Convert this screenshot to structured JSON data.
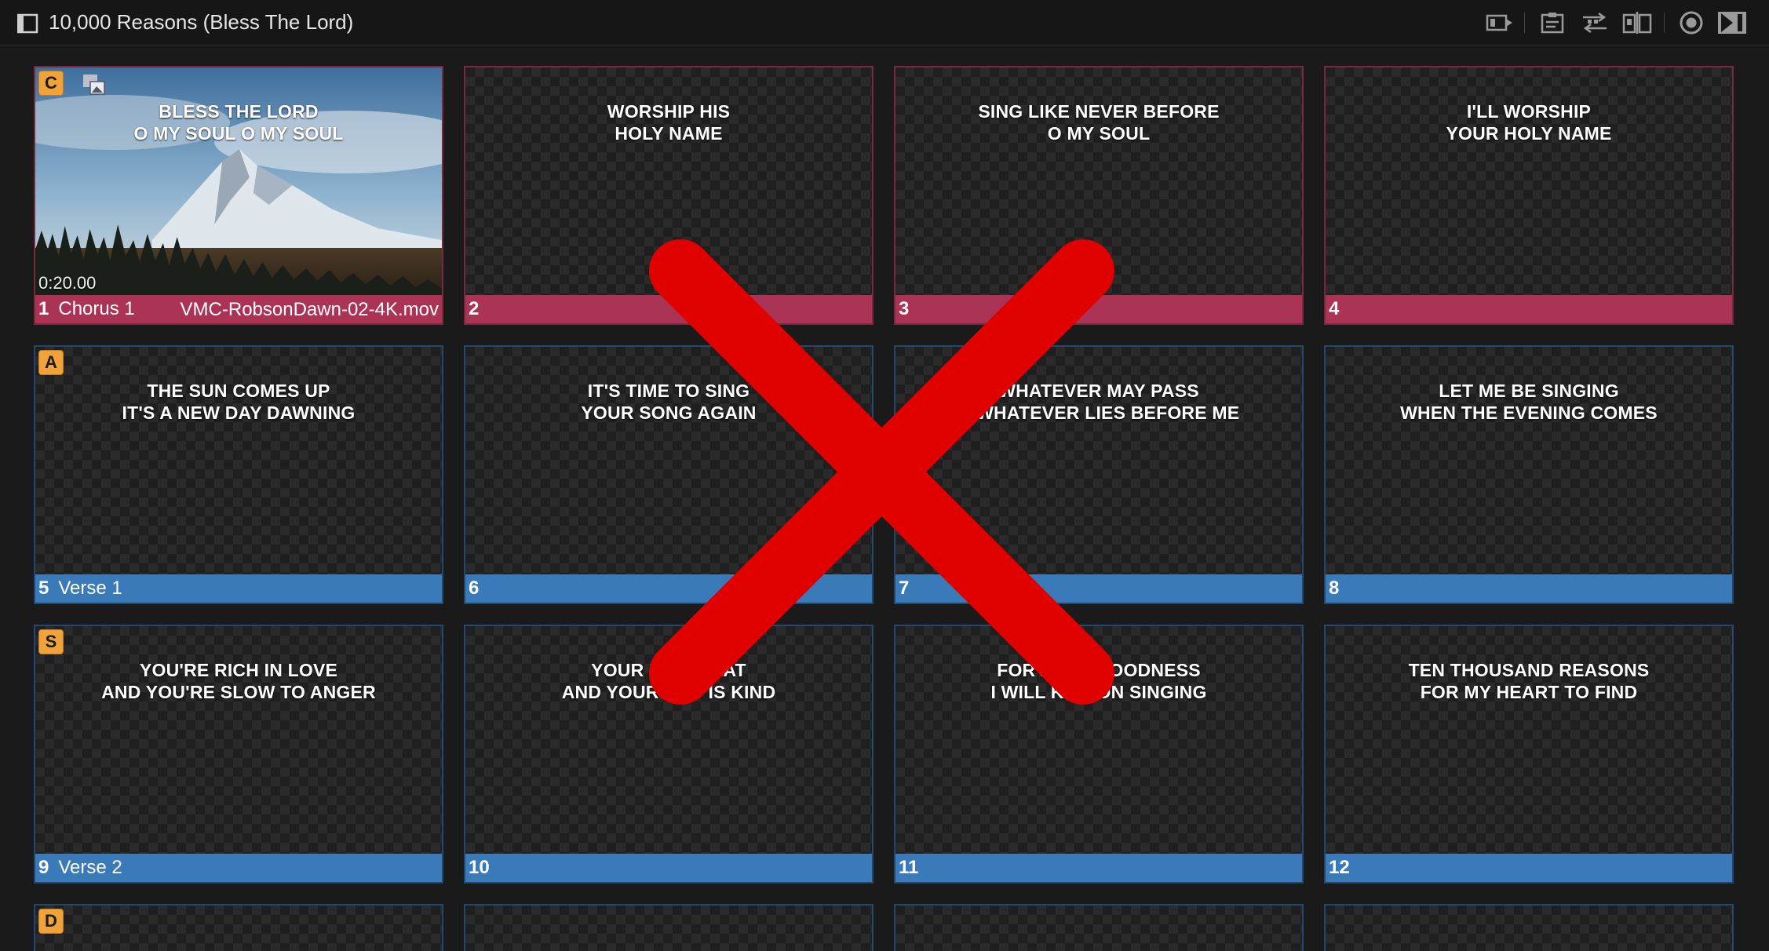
{
  "window": {
    "title": "10,000 Reasons (Bless The Lord)"
  },
  "toolbar": {
    "icons": [
      "output-icon",
      "clipboard-icon",
      "arrange-icon",
      "split-view-icon",
      "record-icon",
      "next-icon"
    ]
  },
  "colors": {
    "chorus": "#ab3356",
    "verse": "#3a7ab8",
    "badge": "#f0a33a",
    "overlay_x": "#e00000"
  },
  "slides": [
    {
      "number": "1",
      "group": "Chorus 1",
      "badge": "C",
      "line1": "BLESS THE LORD",
      "line2": "O MY SOUL O MY SOUL",
      "file": "VMC-RobsonDawn-02-4K.mov",
      "timecode": "0:20.00"
    },
    {
      "number": "2",
      "group": "",
      "line1": "WORSHIP HIS",
      "line2": "HOLY NAME"
    },
    {
      "number": "3",
      "group": "",
      "line1": "SING LIKE NEVER BEFORE",
      "line2": "O MY SOUL"
    },
    {
      "number": "4",
      "group": "",
      "line1": "I'LL WORSHIP",
      "line2": "YOUR HOLY NAME"
    },
    {
      "number": "5",
      "group": "Verse 1",
      "badge": "A",
      "line1": "THE SUN COMES UP",
      "line2": "IT'S A NEW DAY DAWNING"
    },
    {
      "number": "6",
      "group": "",
      "line1": "IT'S TIME TO SING",
      "line2": "YOUR SONG AGAIN"
    },
    {
      "number": "7",
      "group": "",
      "line1": "WHATEVER MAY PASS",
      "line2": "D WHATEVER LIES BEFORE ME"
    },
    {
      "number": "8",
      "group": "",
      "line1": "LET ME BE SINGING",
      "line2": "WHEN THE EVENING COMES"
    },
    {
      "number": "9",
      "group": "Verse 2",
      "badge": "S",
      "line1": "YOU'RE RICH IN LOVE",
      "line2": "AND YOU'RE SLOW TO ANGER"
    },
    {
      "number": "10",
      "group": "",
      "line1": "YOUR NA       EAT",
      "line2": "AND YOUR H      IS KIND"
    },
    {
      "number": "11",
      "group": "",
      "line1": "FOR AL      GOODNESS",
      "line2": "I WILL KE    ON SINGING"
    },
    {
      "number": "12",
      "group": "",
      "line1": "TEN THOUSAND REASONS",
      "line2": "FOR MY HEART TO FIND"
    }
  ],
  "partial_row": {
    "badge": "D"
  }
}
